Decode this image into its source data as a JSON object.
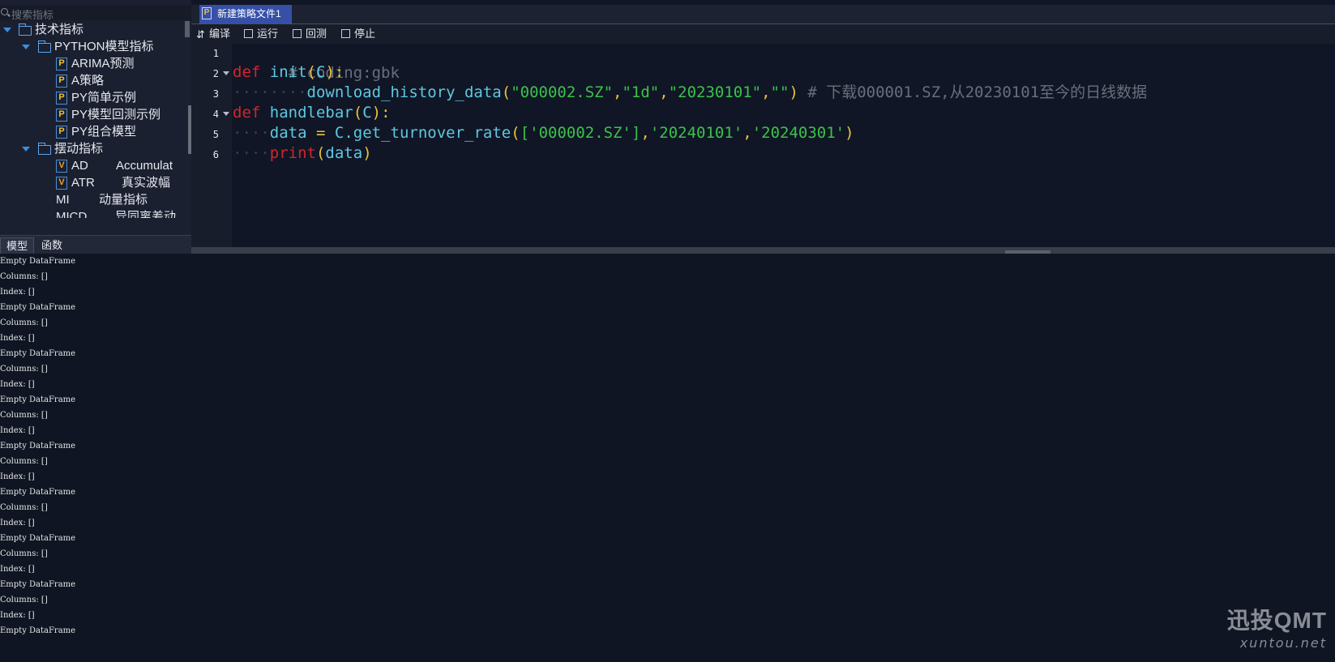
{
  "sidebar": {
    "search_placeholder": "搜索指标",
    "tree": {
      "root": "技术指标",
      "python_group": "PYTHON模型指标",
      "python_items": [
        "ARIMA预测",
        "A策略",
        "PY简单示例",
        "PY模型回测示例",
        "PY组合模型"
      ],
      "swing_group": "摆动指标",
      "swing_items": [
        {
          "code": "AD",
          "desc": "Accumulat",
          "icon": "v"
        },
        {
          "code": "ATR",
          "desc": "真实波幅",
          "icon": "v"
        },
        {
          "code": "MI",
          "desc": "动量指标",
          "icon": ""
        },
        {
          "code": "MICD",
          "desc": "异同离差动",
          "icon": ""
        }
      ]
    },
    "tabs": [
      "模型",
      "函数"
    ]
  },
  "editor": {
    "tab_label": "新建策略文件1",
    "tab_icon": "P",
    "toolbar": [
      "编译",
      "运行",
      "回测",
      "停止"
    ],
    "line_numbers": [
      "1",
      "2",
      "3",
      "4",
      "5",
      "6"
    ],
    "code": {
      "l1": "# coding:gbk",
      "l2_kw": "def",
      "l2_fn": "init",
      "l2_arg": "C",
      "l3_fn": "download_history_data",
      "l3_args": [
        "\"000002.SZ\"",
        "\"1d\"",
        "\"20230101\"",
        "\"\""
      ],
      "l3_comment": "# 下载000001.SZ,从20230101至今的日线数据",
      "l4_kw": "def",
      "l4_fn": "handlebar",
      "l4_arg": "C",
      "l5_var": "data",
      "l5_obj": "C.get_turnover_rate",
      "l5_args": [
        "['000002.SZ']",
        "'20240101'",
        "'20240301'"
      ],
      "l6_fn": "print",
      "l6_arg": "data"
    }
  },
  "output": {
    "lines": [
      "Empty DataFrame",
      "Columns: []",
      "Index: []",
      "Empty DataFrame",
      "Columns: []",
      "Index: []",
      "Empty DataFrame",
      "Columns: []",
      "Index: []",
      "Empty DataFrame",
      "Columns: []",
      "Index: []",
      "Empty DataFrame",
      "Columns: []",
      "Index: []",
      "Empty DataFrame",
      "Columns: []",
      "Index: []",
      "Empty DataFrame",
      "Columns: []",
      "Index: []",
      "Empty DataFrame",
      "Columns: []",
      "Index: []",
      "Empty DataFrame"
    ]
  },
  "watermark": {
    "brand": "迅投QMT",
    "site": "xuntou.net"
  },
  "colors": {
    "keyword": "#d2262a",
    "function": "#5ec8e0",
    "paren": "#e8c33a",
    "string": "#3cc24a",
    "comment": "#6a6e7a",
    "tab_active": "#3650a8"
  }
}
